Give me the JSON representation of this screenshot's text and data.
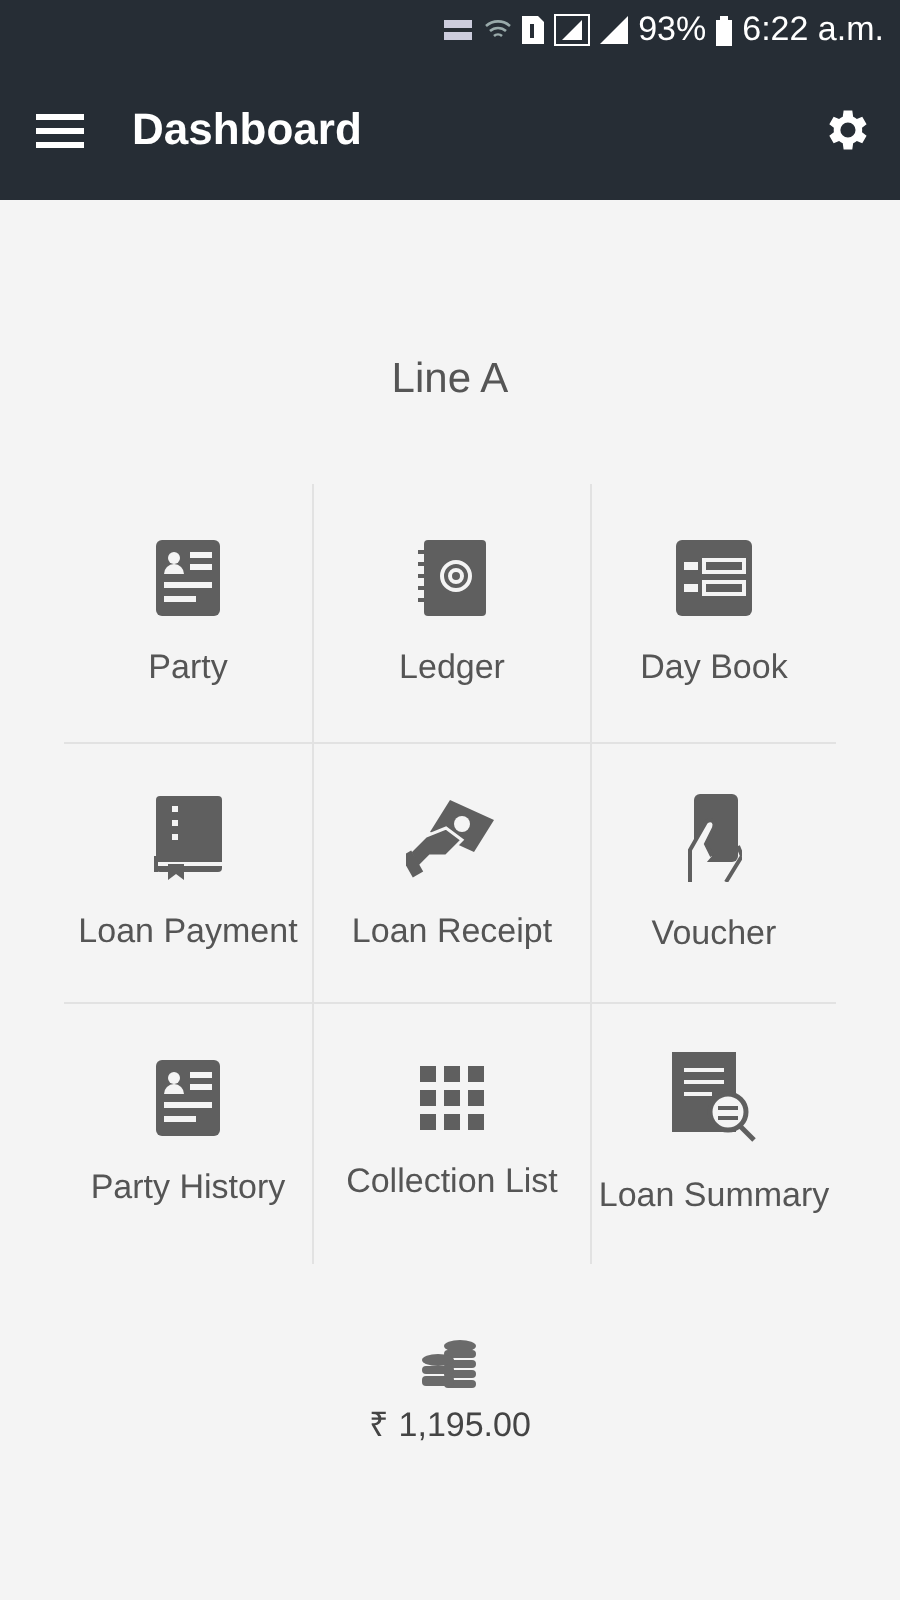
{
  "status_bar": {
    "battery": "93%",
    "time": "6:22 a.m."
  },
  "app_bar": {
    "title": "Dashboard"
  },
  "line_title": "Line A",
  "tiles": [
    {
      "label": "Party"
    },
    {
      "label": "Ledger"
    },
    {
      "label": "Day Book"
    },
    {
      "label": "Loan Payment"
    },
    {
      "label": "Loan Receipt"
    },
    {
      "label": "Voucher"
    },
    {
      "label": "Party History"
    },
    {
      "label": "Collection List"
    },
    {
      "label": "Loan Summary"
    }
  ],
  "total": "₹ 1,195.00"
}
